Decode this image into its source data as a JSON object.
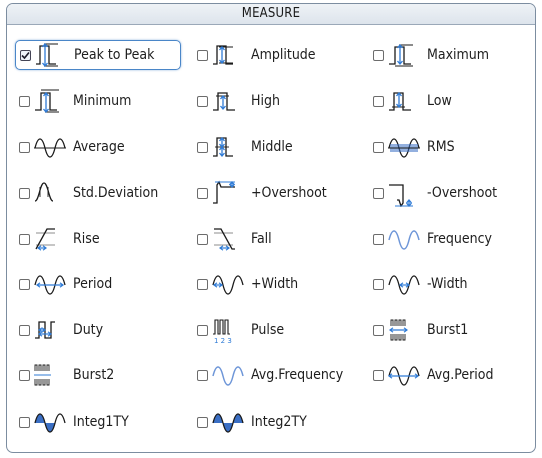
{
  "dialog": {
    "title": "MEASURE"
  },
  "items": [
    {
      "label": "Peak to Peak",
      "icon": "peak-to-peak-icon",
      "checked": true,
      "selected": true
    },
    {
      "label": "Amplitude",
      "icon": "amplitude-icon",
      "checked": false
    },
    {
      "label": "Maximum",
      "icon": "maximum-icon",
      "checked": false
    },
    {
      "label": "Minimum",
      "icon": "minimum-icon",
      "checked": false
    },
    {
      "label": "High",
      "icon": "high-icon",
      "checked": false
    },
    {
      "label": "Low",
      "icon": "low-icon",
      "checked": false
    },
    {
      "label": "Average",
      "icon": "average-icon",
      "checked": false
    },
    {
      "label": "Middle",
      "icon": "middle-icon",
      "checked": false
    },
    {
      "label": "RMS",
      "icon": "rms-icon",
      "checked": false
    },
    {
      "label": "Std.Deviation",
      "icon": "std-deviation-icon",
      "checked": false
    },
    {
      "label": "+Overshoot",
      "icon": "plus-overshoot-icon",
      "checked": false
    },
    {
      "label": "-Overshoot",
      "icon": "minus-overshoot-icon",
      "checked": false
    },
    {
      "label": "Rise",
      "icon": "rise-icon",
      "checked": false
    },
    {
      "label": "Fall",
      "icon": "fall-icon",
      "checked": false
    },
    {
      "label": "Frequency",
      "icon": "frequency-icon",
      "checked": false
    },
    {
      "label": "Period",
      "icon": "period-icon",
      "checked": false
    },
    {
      "label": "+Width",
      "icon": "plus-width-icon",
      "checked": false
    },
    {
      "label": "-Width",
      "icon": "minus-width-icon",
      "checked": false
    },
    {
      "label": "Duty",
      "icon": "duty-icon",
      "checked": false
    },
    {
      "label": "Pulse",
      "icon": "pulse-icon",
      "checked": false
    },
    {
      "label": "Burst1",
      "icon": "burst1-icon",
      "checked": false
    },
    {
      "label": "Burst2",
      "icon": "burst2-icon",
      "checked": false
    },
    {
      "label": "Avg.Frequency",
      "icon": "avg-frequency-icon",
      "checked": false
    },
    {
      "label": "Avg.Period",
      "icon": "avg-period-icon",
      "checked": false
    },
    {
      "label": "Integ1TY",
      "icon": "integ1ty-icon",
      "checked": false
    },
    {
      "label": "Integ2TY",
      "icon": "integ2ty-icon",
      "checked": false
    }
  ],
  "colors": {
    "wave": "#1a1a1a",
    "marker_blue": "#2f7bd6",
    "freq_blue": "#6e96d8",
    "fill_blue": "#3b6fc4"
  }
}
